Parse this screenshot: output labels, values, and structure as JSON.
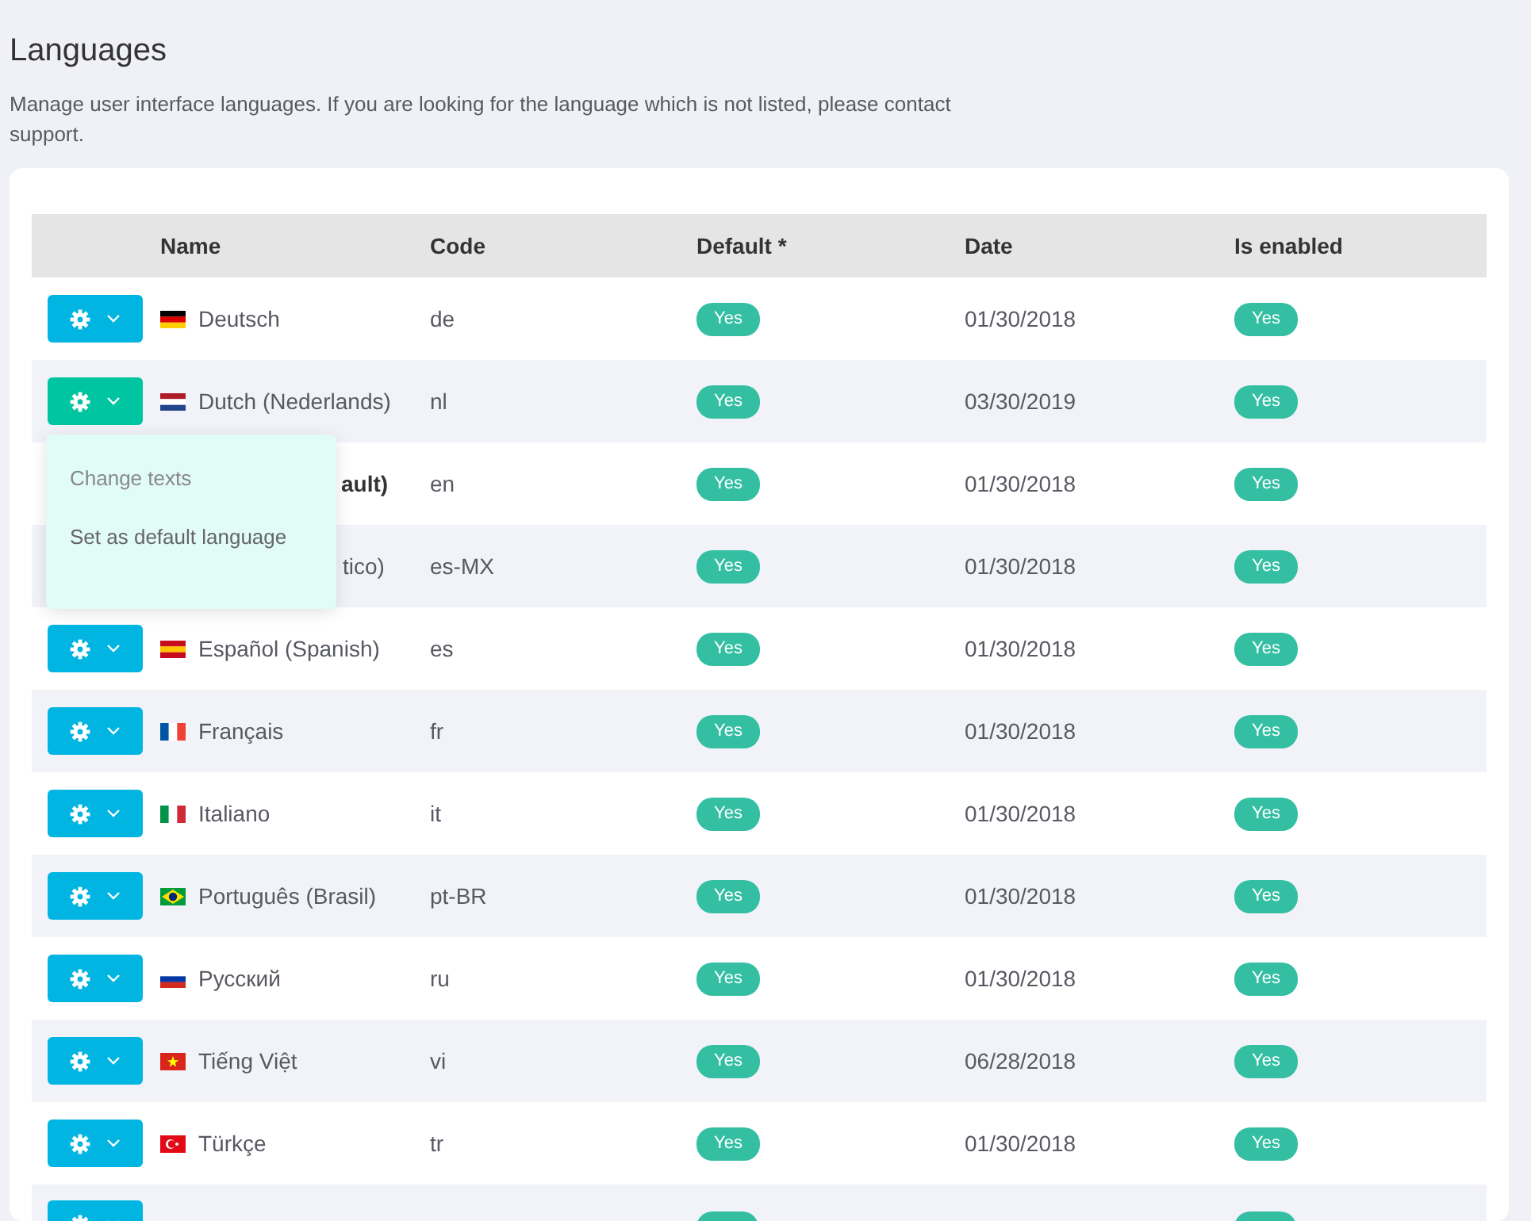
{
  "page": {
    "title": "Languages",
    "description": "Manage user interface languages. If you are looking for the language which is not listed, please contact support."
  },
  "table": {
    "columns": [
      "Name",
      "Code",
      "Default *",
      "Date",
      "Is enabled"
    ],
    "rows": [
      {
        "kind": "full",
        "open": false,
        "flag": {
          "kind": "de"
        },
        "name": "Deutsch",
        "bold": false,
        "code": "de",
        "default": "Yes",
        "date": "01/30/2018",
        "enabled": "Yes"
      },
      {
        "kind": "full",
        "open": true,
        "flag": {
          "kind": "nl"
        },
        "name": "Dutch (Nederlands)",
        "bold": false,
        "code": "nl",
        "default": "Yes",
        "date": "03/30/2019",
        "enabled": "Yes"
      },
      {
        "kind": "covered",
        "name": "ault)",
        "bold": true,
        "code": "en",
        "default": "Yes",
        "date": "01/30/2018",
        "enabled": "Yes"
      },
      {
        "kind": "covered",
        "name": "tico)",
        "bold": false,
        "code": "es-MX",
        "default": "Yes",
        "date": "01/30/2018",
        "enabled": "Yes"
      },
      {
        "kind": "full",
        "open": false,
        "flag": {
          "kind": "es"
        },
        "name": "Español (Spanish)",
        "bold": false,
        "code": "es",
        "default": "Yes",
        "date": "01/30/2018",
        "enabled": "Yes"
      },
      {
        "kind": "full",
        "open": false,
        "flag": {
          "kind": "fr"
        },
        "name": "Français",
        "bold": false,
        "code": "fr",
        "default": "Yes",
        "date": "01/30/2018",
        "enabled": "Yes"
      },
      {
        "kind": "full",
        "open": false,
        "flag": {
          "kind": "it"
        },
        "name": "Italiano",
        "bold": false,
        "code": "it",
        "default": "Yes",
        "date": "01/30/2018",
        "enabled": "Yes"
      },
      {
        "kind": "full",
        "open": false,
        "flag": {
          "kind": "br"
        },
        "name": "Português (Brasil)",
        "bold": false,
        "code": "pt-BR",
        "default": "Yes",
        "date": "01/30/2018",
        "enabled": "Yes"
      },
      {
        "kind": "full",
        "open": false,
        "flag": {
          "kind": "ru"
        },
        "name": "Русский",
        "bold": false,
        "code": "ru",
        "default": "Yes",
        "date": "01/30/2018",
        "enabled": "Yes"
      },
      {
        "kind": "full",
        "open": false,
        "flag": {
          "kind": "vn"
        },
        "name": "Tiếng Việt",
        "bold": false,
        "code": "vi",
        "default": "Yes",
        "date": "06/28/2018",
        "enabled": "Yes"
      },
      {
        "kind": "full",
        "open": false,
        "flag": {
          "kind": "tr"
        },
        "name": "Türkçe",
        "bold": false,
        "code": "tr",
        "default": "Yes",
        "date": "01/30/2018",
        "enabled": "Yes"
      },
      {
        "kind": "cut",
        "open": false
      }
    ]
  },
  "dropdown": {
    "items": [
      "Change texts",
      "Set as default language"
    ]
  }
}
